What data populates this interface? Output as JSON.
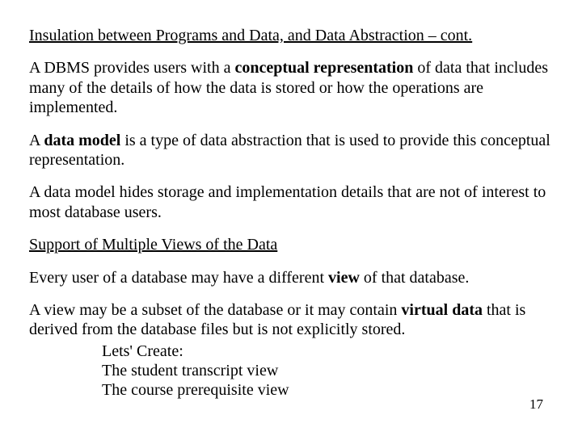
{
  "heading1": "Insulation between Programs and Data, and Data Abstraction – cont.",
  "p1_a": "A DBMS provides users with a ",
  "p1_b": "conceptual representation",
  "p1_c": " of data that includes many of the details of how the data is stored or how the operations are implemented.",
  "p2_a": "A ",
  "p2_b": "data model",
  "p2_c": " is a type of data abstraction that is used to provide this conceptual representation.",
  "p3": "A data model hides storage and implementation details that are not of interest to most database users.",
  "heading2": "Support of Multiple Views of the Data",
  "p4_a": "Every user of a database may have a different ",
  "p4_b": "view",
  "p4_c": " of that database.",
  "p5_a": "A view may be a subset of the database or it may contain ",
  "p5_b": "virtual data",
  "p5_c": " that is derived from the database files but is not explicitly stored.",
  "lets1": "Lets' Create:",
  "lets2": "The student transcript view",
  "lets3": "The course prerequisite view",
  "pageNum": "17"
}
